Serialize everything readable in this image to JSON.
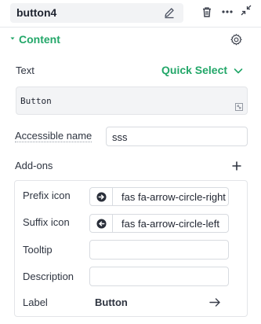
{
  "header": {
    "component_name": "button4",
    "icons": [
      "pencil-icon",
      "trash-icon",
      "more-icon",
      "collapse-icon"
    ]
  },
  "content_section": {
    "title": "Content",
    "text_label": "Text",
    "quick_select_label": "Quick Select",
    "text_value": "Button",
    "accessible_name_label": "Accessible name",
    "accessible_name_value": "sss"
  },
  "addons": {
    "title": "Add-ons",
    "prefix_icon_label": "Prefix icon",
    "prefix_icon_value": "fas fa-arrow-circle-right",
    "suffix_icon_label": "Suffix icon",
    "suffix_icon_value": "fas fa-arrow-circle-left",
    "tooltip_label": "Tooltip",
    "tooltip_value": "",
    "description_label": "Description",
    "description_value": "",
    "label_label": "Label",
    "label_value": "Button"
  },
  "colors": {
    "accent_green": "#23a769",
    "text_dark": "#2e3440"
  }
}
